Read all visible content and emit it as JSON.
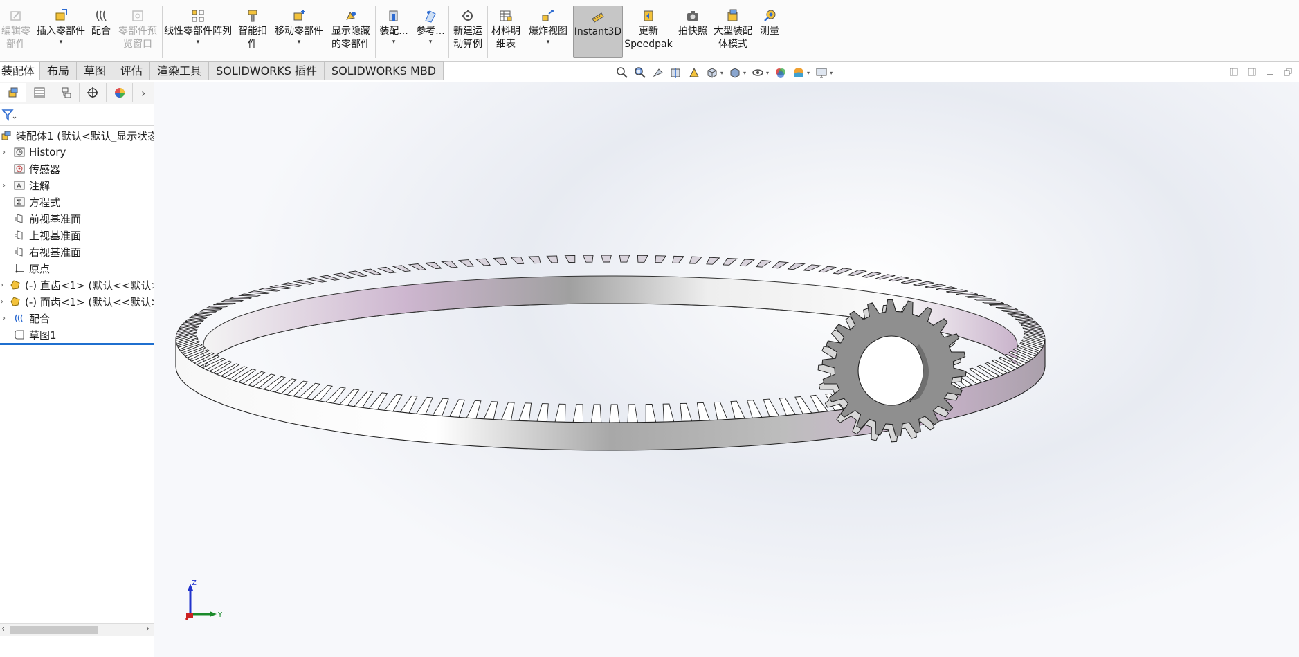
{
  "ribbon": {
    "buttons": [
      {
        "id": "edit-component",
        "label": "编辑零\n部件",
        "disabled": true,
        "icon": "edit-component-icon"
      },
      {
        "id": "insert-components",
        "label": "插入零部件",
        "dropdown": true,
        "icon": "insert-component-icon"
      },
      {
        "id": "mate",
        "label": "配合",
        "icon": "mate-icon"
      },
      {
        "id": "component-preview",
        "label": "零部件预\n览窗口",
        "disabled": true,
        "icon": "preview-window-icon"
      },
      {
        "id": "linear-pattern",
        "label": "线性零部件阵列",
        "dropdown": true,
        "icon": "linear-pattern-icon"
      },
      {
        "id": "smart-fasteners",
        "label": "智能扣\n件",
        "icon": "smart-fastener-icon"
      },
      {
        "id": "move-component",
        "label": "移动零部件",
        "dropdown": true,
        "icon": "move-component-icon"
      },
      {
        "id": "show-hidden",
        "label": "显示隐藏\n的零部件",
        "icon": "show-hidden-icon"
      },
      {
        "id": "assembly-features",
        "label": "装配...",
        "dropdown": true,
        "icon": "assembly-feature-icon"
      },
      {
        "id": "reference-geometry",
        "label": "参考...",
        "dropdown": true,
        "icon": "reference-geometry-icon"
      },
      {
        "id": "new-motion-study",
        "label": "新建运\n动算例",
        "icon": "motion-study-icon"
      },
      {
        "id": "bom",
        "label": "材料明\n细表",
        "icon": "bom-icon"
      },
      {
        "id": "exploded-view",
        "label": "爆炸视图",
        "dropdown": true,
        "icon": "exploded-view-icon"
      },
      {
        "id": "instant3d",
        "label": "Instant3D",
        "active": true,
        "icon": "instant3d-icon"
      },
      {
        "id": "update-speedpak",
        "label": "更新\nSpeedpak",
        "icon": "speedpak-icon"
      },
      {
        "id": "take-snapshot",
        "label": "拍快照",
        "icon": "camera-icon"
      },
      {
        "id": "large-assembly",
        "label": "大型装配\n体模式",
        "icon": "large-assembly-icon"
      },
      {
        "id": "measure",
        "label": "测量",
        "icon": "measure-icon"
      }
    ]
  },
  "tabs": [
    {
      "label": "装配体",
      "active": true
    },
    {
      "label": "布局"
    },
    {
      "label": "草图"
    },
    {
      "label": "评估"
    },
    {
      "label": "渲染工具"
    },
    {
      "label": "SOLIDWORKS 插件"
    },
    {
      "label": "SOLIDWORKS MBD"
    }
  ],
  "tree": {
    "root": "装配体1 (默认<默认_显示状态",
    "items": [
      {
        "label": "History",
        "icon": "history-icon",
        "expandable": true
      },
      {
        "label": "传感器",
        "icon": "sensor-icon",
        "expandable": false
      },
      {
        "label": "注解",
        "icon": "annotation-icon",
        "expandable": true
      },
      {
        "label": "方程式",
        "icon": "equation-icon",
        "expandable": false
      },
      {
        "label": "前视基准面",
        "icon": "plane-icon",
        "expandable": false
      },
      {
        "label": "上视基准面",
        "icon": "plane-icon",
        "expandable": false
      },
      {
        "label": "右视基准面",
        "icon": "plane-icon",
        "expandable": false
      },
      {
        "label": "原点",
        "icon": "origin-icon",
        "expandable": false
      },
      {
        "label": "(-) 直齿<1> (默认<<默认>",
        "icon": "part-icon",
        "expandable": true
      },
      {
        "label": "(-) 面齿<1> (默认<<默认>",
        "icon": "part-icon",
        "expandable": true
      },
      {
        "label": "配合",
        "icon": "mates-folder-icon",
        "expandable": true
      },
      {
        "label": "草图1",
        "icon": "sketch-icon",
        "expandable": false,
        "selected": true
      }
    ]
  },
  "triad": {
    "z": "Z",
    "y": "Y"
  },
  "colors": {
    "accent": "#1f6fcf",
    "gear_face": "#8f8f8f",
    "ring_pink": "#c9b3cb",
    "ring_gray": "#9a9a9a"
  }
}
